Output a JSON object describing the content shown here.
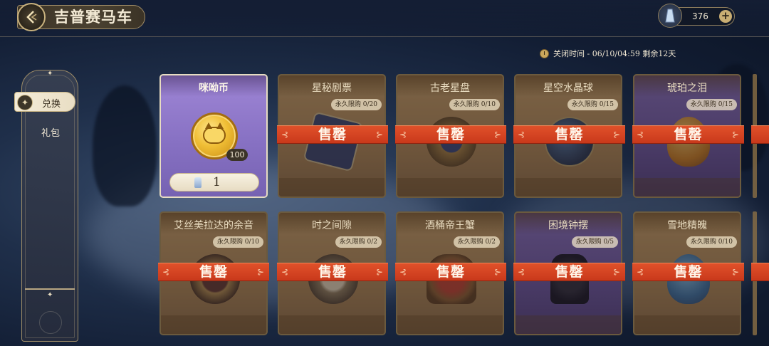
{
  "header": {
    "title": "吉普赛马车",
    "currency_value": "376",
    "currency_add_label": "+",
    "close_label": "关闭时间 - 06/10/04:59 剩余12天"
  },
  "sidebar": {
    "tabs": [
      {
        "label": "兑换",
        "active": true
      },
      {
        "label": "礼包",
        "active": false
      }
    ]
  },
  "items": [
    {
      "name": "咪呦币",
      "limit": "",
      "sold_out": false,
      "badge_count": "100",
      "price": "1"
    },
    {
      "name": "星秘剧票",
      "limit": "永久限购 0/20",
      "sold_out": true
    },
    {
      "name": "古老星盘",
      "limit": "永久限购 0/10",
      "sold_out": true
    },
    {
      "name": "星空水晶球",
      "limit": "永久限购 0/15",
      "sold_out": true
    },
    {
      "name": "琥珀之泪",
      "limit": "永久限购 0/15",
      "sold_out": true
    },
    {
      "name": "艾丝美拉达的余音",
      "limit": "永久限购 0/10",
      "sold_out": true
    },
    {
      "name": "时之间隙",
      "limit": "永久限购 0/2",
      "sold_out": true
    },
    {
      "name": "酒桶帝王蟹",
      "limit": "永久限购 0/2",
      "sold_out": true
    },
    {
      "name": "困境钟摆",
      "limit": "永久限购 0/5",
      "sold_out": true
    },
    {
      "name": "雪地精魄",
      "limit": "永久限购 0/10",
      "sold_out": true
    }
  ],
  "sold_out_label": "售罄",
  "colors": {
    "banner": "#d8451f",
    "active_card": "#8771c3",
    "gold_card": "#b48b55"
  }
}
